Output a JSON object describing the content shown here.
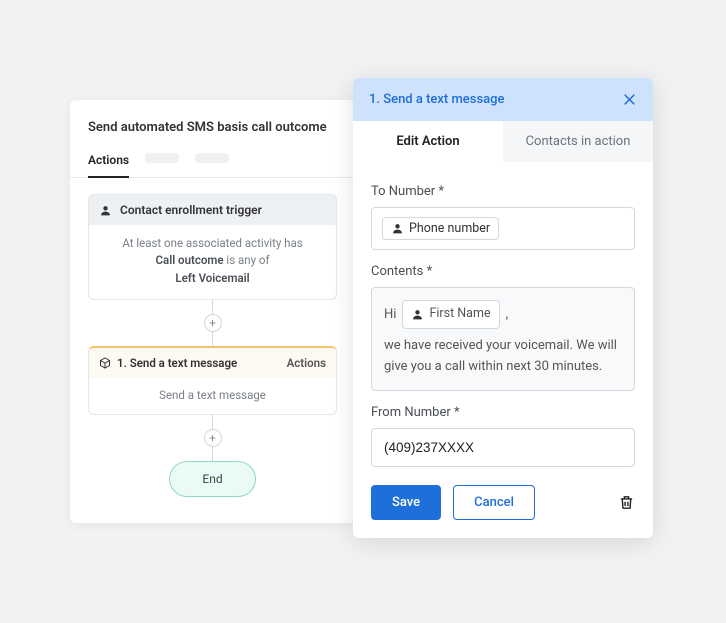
{
  "workflow": {
    "title": "Send automated SMS basis call outcome",
    "tabs": {
      "actions": "Actions"
    },
    "trigger": {
      "title": "Contact enrollment trigger",
      "line1": "At least one associated activity has",
      "field": "Call outcome",
      "op": "is any of",
      "value": "Left Voicemail"
    },
    "action": {
      "label": "1. Send a text message",
      "menu": "Actions",
      "caption": "Send a text message"
    },
    "end": "End"
  },
  "editor": {
    "header": "1. Send a text message",
    "tabs": {
      "edit": "Edit Action",
      "contacts": "Contacts in action"
    },
    "to_label": "To Number *",
    "to_chip": "Phone number",
    "contents_label": "Contents *",
    "contents": {
      "prefix": "Hi",
      "chip": "First Name",
      "after_chip": ",",
      "body": "we have received your voicemail. We will give you a call within next 30 minutes."
    },
    "from_label": "From Number *",
    "from_value": "(409)237XXXX",
    "save": "Save",
    "cancel": "Cancel"
  }
}
